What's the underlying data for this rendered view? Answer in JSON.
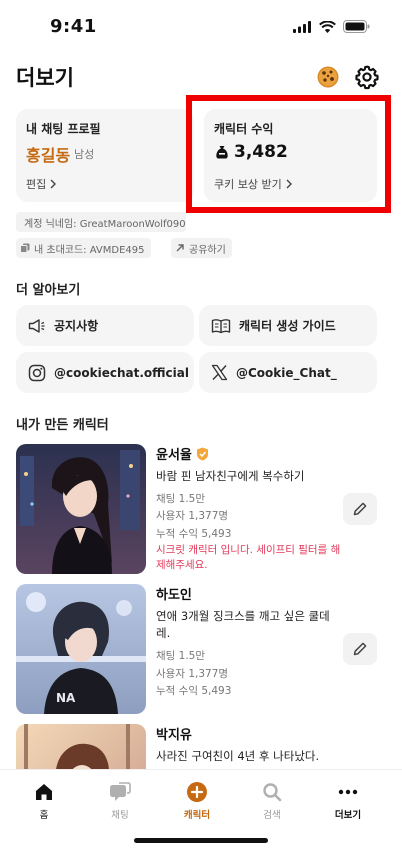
{
  "status": {
    "time": "9:41"
  },
  "header": {
    "title": "더보기",
    "cookie_icon": "cookie-icon",
    "settings_icon": "gear-icon"
  },
  "profile_card": {
    "label": "내 채팅 프로필",
    "name": "홍길동",
    "gender": "남성",
    "edit_label": "편집"
  },
  "income_card": {
    "label": "캐릭터 수익",
    "amount": "3,482",
    "reward_label": "쿠키 보상 받기"
  },
  "account": {
    "nickname": "계정 닉네임: GreatMaroonWolf0907",
    "invite_code": "내 초대코드: AVMDE495",
    "share_label": "공유하기"
  },
  "learn_more": {
    "title": "더 알아보기",
    "notice": "공지사항",
    "guide": "캐릭터 생성 가이드",
    "instagram": "@cookiechat.official",
    "x_account": "@Cookie_Chat_"
  },
  "my_characters": {
    "title": "내가 만든 캐릭터",
    "items": [
      {
        "name": "윤서율",
        "desc": "바람 핀 남자친구에게 복수하기",
        "chats": "채팅 1.5만",
        "users": "사용자 1,377명",
        "revenue": "누적 수익 5,493",
        "warning": "시크릿 캐릭터 입니다. 세이프티 필터를 해제해주세요."
      },
      {
        "name": "하도인",
        "desc": "연애 3개월 징크스를 깨고 싶은 쿨데레.",
        "chats": "채팅 1.5만",
        "users": "사용자 1,377명",
        "revenue": "누적 수익 5,493"
      },
      {
        "name": "박지유",
        "desc": "사라진 구여친이 4년 후 나타났다."
      }
    ]
  },
  "nav": {
    "home": "홈",
    "chat": "채팅",
    "character": "캐릭터",
    "search": "검색",
    "more": "더보기",
    "accent": "#c56a12"
  }
}
